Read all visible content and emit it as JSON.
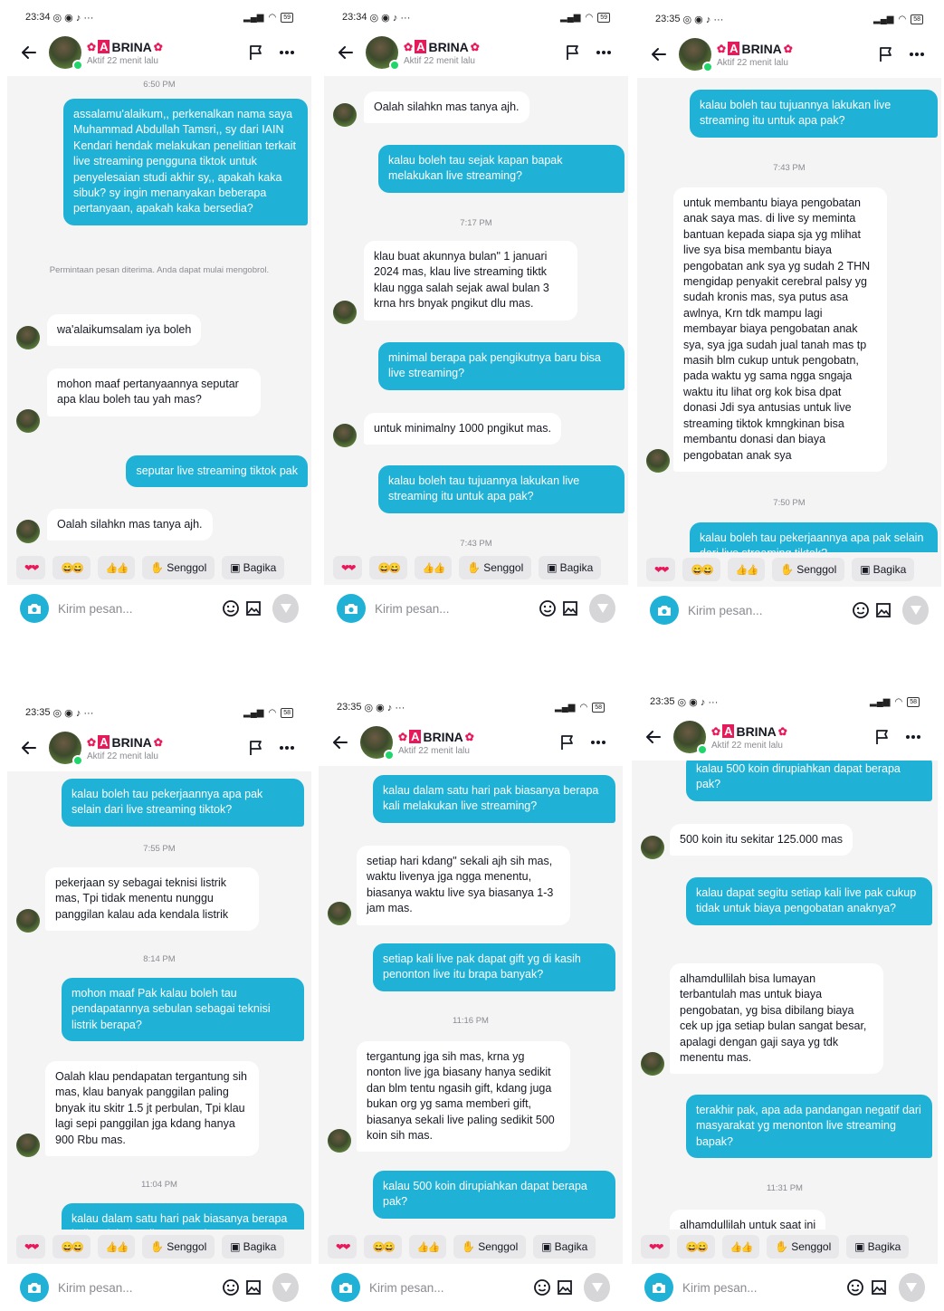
{
  "common": {
    "contact_name": "BRINA",
    "contact_name_initial": "A",
    "contact_status": "Aktif 22 menit lalu",
    "compose_placeholder": "Kirim pesan...",
    "quick_replies": [
      "❤❤",
      "😄😄",
      "👍👍",
      "Senggol",
      "Bagika"
    ],
    "accent_color": "#20b1d6",
    "online_color": "#20d56b"
  },
  "panels": [
    {
      "time": "23:34",
      "battery": "59",
      "items": [
        {
          "type": "time",
          "text": "6:50 PM"
        },
        {
          "type": "out",
          "text": "assalamu'alaikum,, perkenalkan nama saya Muhammad Abdullah Tamsri,, sy dari IAIN Kendari hendak melakukan penelitian terkait live streaming pengguna tiktok untuk penyelesaian studi akhir sy,, apakah kaka sibuk? sy ingin menanyakan beberapa pertanyaan, apakah kaka bersedia?"
        },
        {
          "type": "system",
          "text": "Permintaan pesan diterima. Anda dapat mulai mengobrol."
        },
        {
          "type": "in",
          "text": "wa'alaikumsalam iya boleh"
        },
        {
          "type": "in",
          "text": "mohon maaf pertanyaannya seputar apa klau boleh tau yah mas?"
        },
        {
          "type": "out",
          "text": "seputar live streaming tiktok pak"
        },
        {
          "type": "in",
          "text": "Oalah silahkn mas tanya ajh."
        }
      ]
    },
    {
      "time": "23:34",
      "battery": "59",
      "items": [
        {
          "type": "in",
          "text": "Oalah silahkn mas tanya ajh."
        },
        {
          "type": "out",
          "text": "kalau boleh tau sejak kapan bapak melakukan live streaming?"
        },
        {
          "type": "time",
          "text": "7:17 PM"
        },
        {
          "type": "in",
          "text": "klau buat akunnya bulan\" 1 januari 2024 mas, klau live streaming tiktk klau ngga salah sejak awal bulan 3 krna hrs bnyak pngikut dlu mas."
        },
        {
          "type": "out",
          "text": "minimal berapa pak pengikutnya baru bisa live streaming?"
        },
        {
          "type": "in",
          "text": "untuk minimalny 1000 pngikut mas."
        },
        {
          "type": "out",
          "text": "kalau boleh tau tujuannya lakukan live streaming itu untuk apa pak?"
        },
        {
          "type": "time",
          "text": "7:43 PM"
        }
      ]
    },
    {
      "time": "23:35",
      "battery": "58",
      "items": [
        {
          "type": "out",
          "text": "kalau boleh tau tujuannya lakukan live streaming itu untuk apa pak?"
        },
        {
          "type": "time",
          "text": "7:43 PM"
        },
        {
          "type": "in",
          "text": "untuk membantu biaya pengobatan anak saya mas. di live sy meminta bantuan kepada siapa sja yg mlihat live sya bisa membantu biaya pengobatan ank sya yg sudah 2 THN mengidap penyakit cerebral palsy yg sudah kronis mas, sya putus asa awlnya, Krn tdk mampu lagi membayar biaya pengobatan anak sya, sya jga sudah jual tanah mas tp masih blm cukup untuk pengobatn, pada waktu yg sama ngga sngaja waktu itu lihat org kok bisa dpat donasi Jdi sya antusias untuk live streaming tiktok kmngkinan bisa membantu donasi dan biaya pengobatan anak sya"
        },
        {
          "type": "time",
          "text": "7:50 PM"
        },
        {
          "type": "out",
          "text": "kalau boleh tau pekerjaannya apa pak selain dari live streaming tiktok?"
        }
      ]
    },
    {
      "time": "23:35",
      "battery": "58",
      "items": [
        {
          "type": "out",
          "text": "kalau boleh tau pekerjaannya apa pak selain dari live streaming tiktok?"
        },
        {
          "type": "time",
          "text": "7:55 PM"
        },
        {
          "type": "in",
          "text": "pekerjaan sy sebagai teknisi listrik mas, Tpi tidak menentu nunggu panggilan kalau ada kendala listrik"
        },
        {
          "type": "time",
          "text": "8:14 PM"
        },
        {
          "type": "out",
          "text": "mohon maaf Pak kalau boleh tau pendapatannya sebulan sebagai teknisi listrik berapa?"
        },
        {
          "type": "in",
          "text": "Oalah klau pendapatan tergantung sih mas, klau banyak panggilan paling bnyak itu skitr 1.5 jt perbulan, Tpi klau lagi sepi panggilan jga kdang hanya 900 Rbu mas."
        },
        {
          "type": "time",
          "text": "11:04 PM"
        },
        {
          "type": "out",
          "text": "kalau dalam satu hari pak biasanya berapa kali melakukan live streaming?"
        }
      ]
    },
    {
      "time": "23:35",
      "battery": "58",
      "items": [
        {
          "type": "out",
          "text": "kalau dalam satu hari pak biasanya berapa kali melakukan live streaming?"
        },
        {
          "type": "in",
          "text": "setiap hari kdang\" sekali ajh sih mas, waktu livenya jga ngga menentu, biasanya waktu live sya biasanya 1-3 jam mas."
        },
        {
          "type": "out",
          "text": "setiap kali live pak dapat gift yg di kasih penonton live itu brapa banyak?"
        },
        {
          "type": "time",
          "text": "11:16 PM"
        },
        {
          "type": "in",
          "text": "tergantung jga sih mas, krna yg nonton live jga biasany hanya sedikit dan blm tentu ngasih gift, kdang juga bukan org yg sama memberi gift, biasanya sekali live paling sedikit 500 koin sih mas."
        },
        {
          "type": "out",
          "text": "kalau 500 koin dirupiahkan dapat berapa pak?"
        }
      ]
    },
    {
      "time": "23:35",
      "battery": "58",
      "items": [
        {
          "type": "out",
          "text": "kalau 500 koin dirupiahkan dapat berapa pak?"
        },
        {
          "type": "in",
          "text": "500 koin itu sekitar 125.000 mas"
        },
        {
          "type": "out",
          "text": "kalau dapat segitu setiap kali live pak cukup tidak untuk biaya pengobatan anaknya?"
        },
        {
          "type": "in",
          "text": "alhamdullilah bisa lumayan terbantulah mas untuk biaya pengobatan, yg bisa dibilang biaya cek up jga setiap bulan sangat besar, apalagi dengan gaji saya yg tdk menentu mas."
        },
        {
          "type": "out",
          "text": "terakhir pak, apa ada pandangan negatif dari masyarakat yg menonton live streaming bapak?"
        },
        {
          "type": "time",
          "text": "11:31 PM"
        },
        {
          "type": "in",
          "text": "alhamdullilah untuk saat ini"
        }
      ]
    }
  ]
}
